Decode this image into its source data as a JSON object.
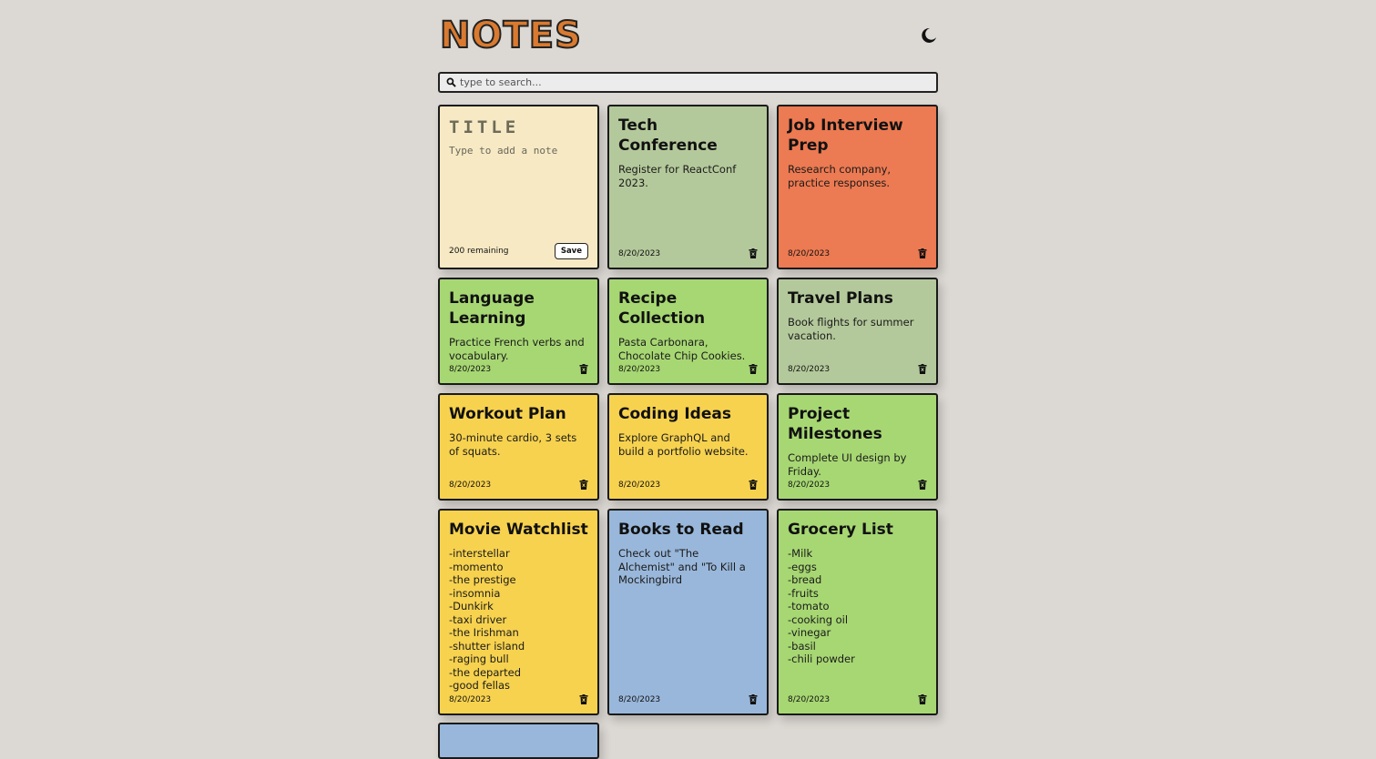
{
  "app": {
    "title": "NOTES"
  },
  "search": {
    "placeholder": "type to search..."
  },
  "new_note": {
    "title_placeholder": "TITLE",
    "body_placeholder": "Type to add a note",
    "remaining": "200 remaining",
    "save_label": "Save"
  },
  "colors": {
    "green_gray": "#b4c99b",
    "orange": "#ec7a52",
    "green": "#a7d773",
    "yellow": "#f7d24f",
    "blue": "#99b7da"
  },
  "notes": [
    {
      "title": "Tech Conference",
      "body": "Register for ReactConf 2023.",
      "date": "8/20/2023",
      "color": "green_gray"
    },
    {
      "title": "Job Interview Prep",
      "body": "Research company, practice responses.",
      "date": "8/20/2023",
      "color": "orange"
    },
    {
      "title": "Language Learning",
      "body": "Practice French verbs and vocabulary.",
      "date": "8/20/2023",
      "color": "green"
    },
    {
      "title": "Recipe Collection",
      "body": "Pasta Carbonara, Chocolate Chip Cookies.",
      "date": "8/20/2023",
      "color": "green"
    },
    {
      "title": "Travel Plans",
      "body": "Book flights for summer vacation.",
      "date": "8/20/2023",
      "color": "green_gray"
    },
    {
      "title": "Workout Plan",
      "body": "30-minute cardio, 3 sets of squats.",
      "date": "8/20/2023",
      "color": "yellow"
    },
    {
      "title": "Coding Ideas",
      "body": "Explore GraphQL and build a portfolio website.",
      "date": "8/20/2023",
      "color": "yellow"
    },
    {
      "title": "Project Milestones",
      "body": "Complete UI design by Friday.",
      "date": "8/20/2023",
      "color": "green"
    },
    {
      "title": "Movie Watchlist",
      "body": "-interstellar\n-momento\n-the prestige\n-insomnia\n-Dunkirk\n-taxi driver\n-the Irishman\n-shutter island\n-raging bull\n-the departed\n-good fellas",
      "date": "8/20/2023",
      "color": "yellow"
    },
    {
      "title": "Books to Read",
      "body": "Check out \"The Alchemist\" and \"To Kill a Mockingbird",
      "date": "8/20/2023",
      "color": "blue"
    },
    {
      "title": "Grocery List",
      "body": "-Milk\n-eggs\n-bread\n-fruits\n-tomato\n-cooking oil\n-vinegar\n-basil\n-chili powder",
      "date": "8/20/2023",
      "color": "green"
    }
  ],
  "icons": {
    "theme_toggle": "moon-icon",
    "search": "search-icon",
    "delete": "trash-icon"
  }
}
